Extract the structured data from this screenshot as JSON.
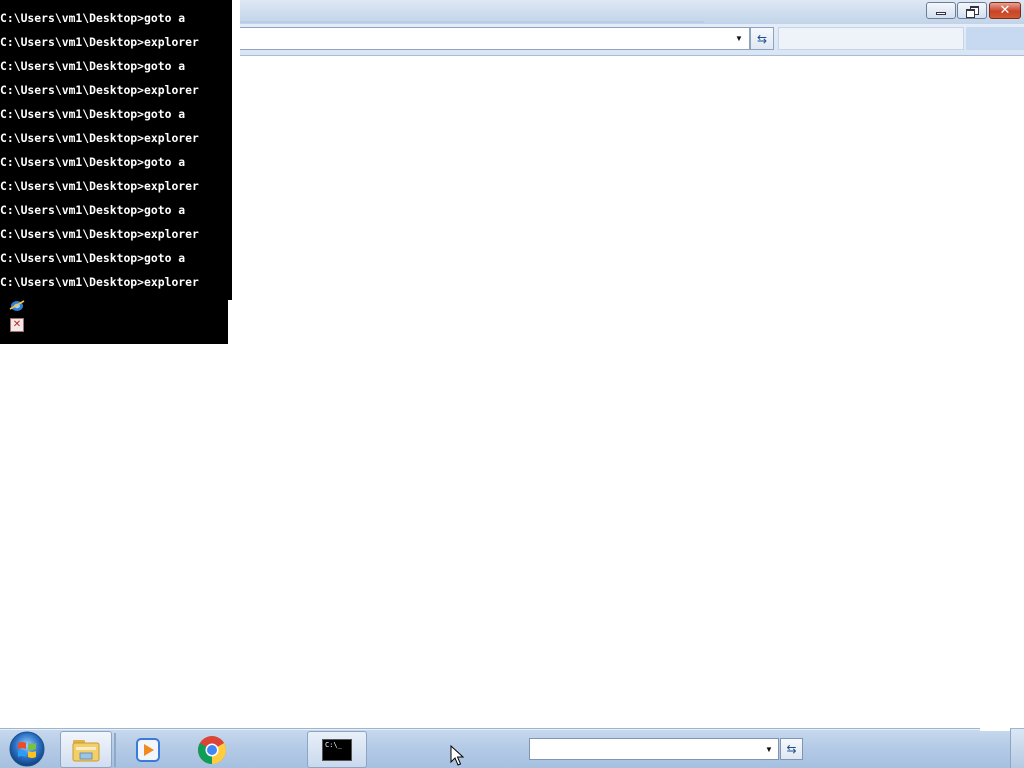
{
  "cmd": {
    "lines": [
      "C:\\Users\\vm1\\Desktop>goto a",
      "C:\\Users\\vm1\\Desktop>explorer",
      "C:\\Users\\vm1\\Desktop>goto a",
      "C:\\Users\\vm1\\Desktop>explorer",
      "C:\\Users\\vm1\\Desktop>goto a",
      "C:\\Users\\vm1\\Desktop>explorer",
      "C:\\Users\\vm1\\Desktop>goto a",
      "C:\\Users\\vm1\\Desktop>explorer",
      "C:\\Users\\vm1\\Desktop>goto a",
      "C:\\Users\\vm1\\Desktop>explorer",
      "C:\\Users\\vm1\\Desktop>goto a",
      "C:\\Users\\vm1\\Desktop>explorer"
    ],
    "icons": [
      "internet-explorer-icon",
      "broken-image-icon"
    ]
  },
  "explorer": {
    "address_value": "",
    "search_placeholder": ""
  },
  "taskbar": {
    "items": [
      {
        "name": "start-button",
        "icon": "windows-logo-icon"
      },
      {
        "name": "windows-explorer",
        "icon": "folder-icon"
      },
      {
        "name": "windows-media-player",
        "icon": "media-player-icon"
      },
      {
        "name": "google-chrome",
        "icon": "chrome-icon"
      },
      {
        "name": "command-prompt",
        "icon": "cmd-icon",
        "label": "C:\\_"
      }
    ],
    "address_value": ""
  },
  "colors": {
    "cmd_background": "#000000",
    "cmd_text": "#ffffff",
    "taskbar": "#b5cbe6",
    "close_button": "#c7442a"
  }
}
